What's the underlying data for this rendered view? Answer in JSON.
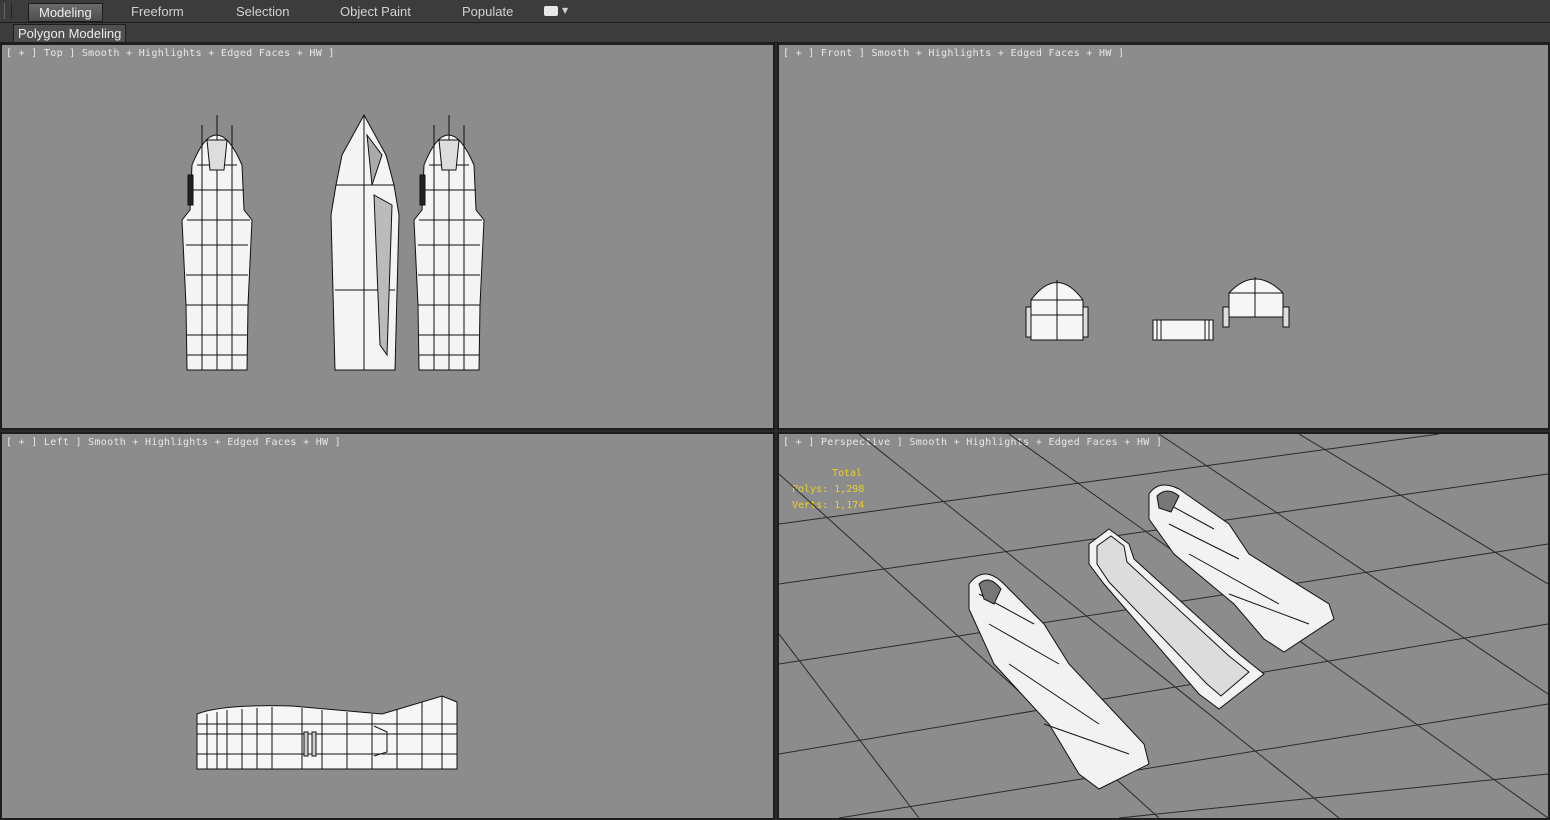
{
  "ribbon": {
    "tabs": [
      "Modeling",
      "Freeform",
      "Selection",
      "Object Paint",
      "Populate"
    ],
    "active_tab": "Modeling"
  },
  "subribbon": {
    "panel_label": "Polygon Modeling"
  },
  "viewports": {
    "top": {
      "label": "[ + ] Top ] Smooth + Highlights + Edged Faces + HW ]"
    },
    "front": {
      "label": "[ + ] Front ] Smooth + Highlights + Edged Faces + HW ]"
    },
    "left": {
      "label": "[ + ] Left ] Smooth + Highlights + Edged Faces + HW ]"
    },
    "perspective": {
      "label": "[ + ] Perspective ] Smooth + Highlights + Edged Faces + HW ]",
      "stats": {
        "title": "Total",
        "polys": "Polys: 1,298",
        "verts": "Verts: 1,174"
      }
    }
  },
  "colors": {
    "viewport_bg": "#8c8c8c",
    "stats_text": "#e8d02a",
    "ui_bg": "#3c3c3c"
  }
}
